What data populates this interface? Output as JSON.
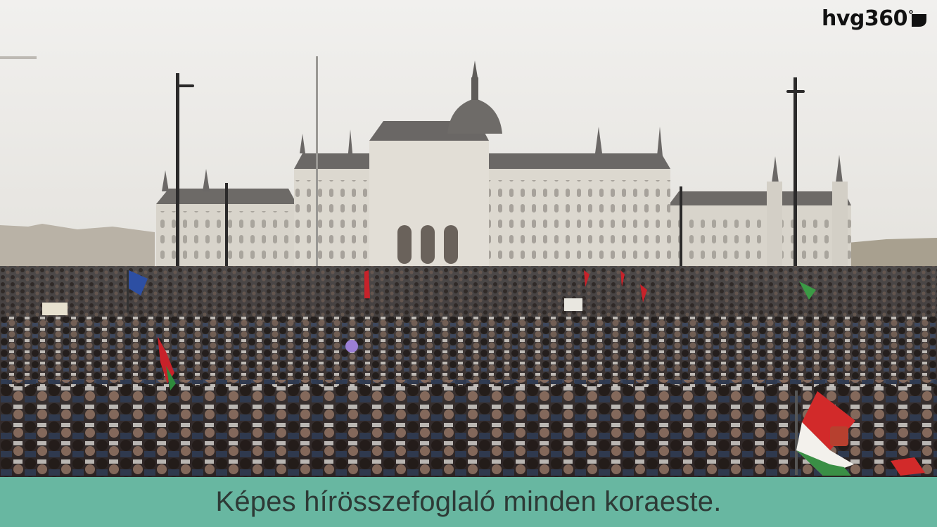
{
  "logo": {
    "text": "hvg360",
    "mark_icon": "play-wedge-icon"
  },
  "caption": {
    "text": "Képes hírösszefoglaló minden koraeste."
  },
  "colors": {
    "caption_background": "#68b7a1",
    "caption_text": "#2d3a36",
    "sky": "#ecebe8",
    "building": "#d9d5cc",
    "roof": "#6f6c69"
  }
}
